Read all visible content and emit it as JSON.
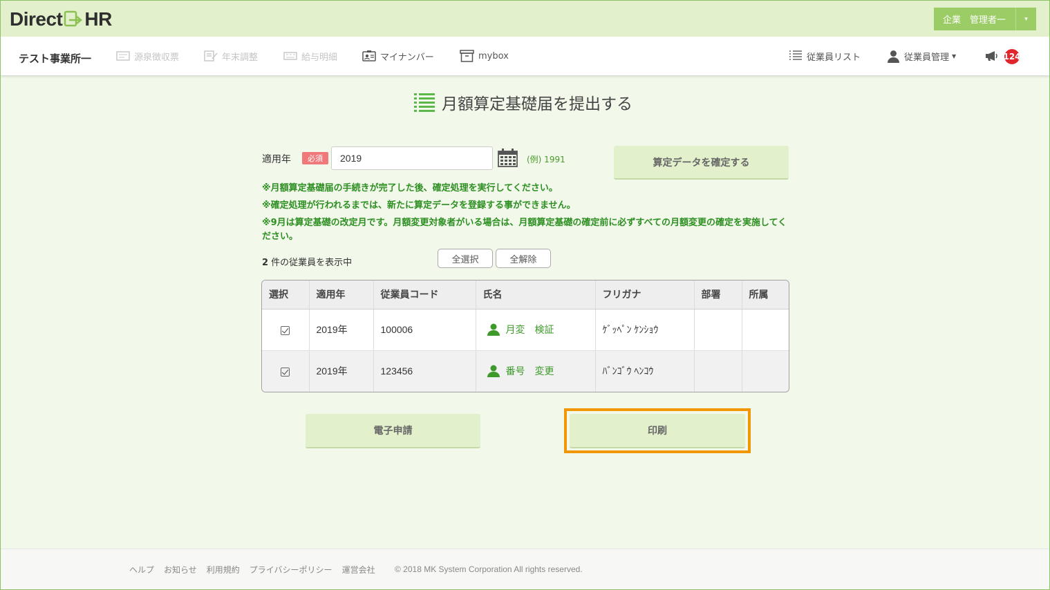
{
  "header": {
    "logo_left": "Direct",
    "logo_right": "HR",
    "user_menu_label": "企業　管理者一",
    "user_menu_caret": "▾"
  },
  "nav": {
    "office_name": "テスト事業所一",
    "items": [
      {
        "label": "源泉徴収票",
        "icon": "receipt-icon",
        "enabled": false
      },
      {
        "label": "年末調整",
        "icon": "document-edit-icon",
        "enabled": false
      },
      {
        "label": "給与明細",
        "icon": "payslip-icon",
        "enabled": false
      },
      {
        "label": "マイナンバー",
        "icon": "id-card-icon",
        "enabled": true
      },
      {
        "label": "mybox",
        "icon": "box-icon",
        "enabled": true
      }
    ],
    "employee_list": "従業員リスト",
    "employee_manage": "従業員管理",
    "notification_count": "124"
  },
  "page": {
    "title": "月額算定基礎届を提出する"
  },
  "form": {
    "year_label": "適用年",
    "required_badge": "必須",
    "year_value": "2019",
    "example": "(例) 1991",
    "confirm_button": "算定データを確定する",
    "notes": [
      "※月額算定基礎届の手続きが完了した後、確定処理を実行してください。",
      "※確定処理が行われるまでは、新たに算定データを登録する事ができません。",
      "※9月は算定基礎の改定月です。月額変更対象者がいる場合は、月額算定基礎の確定前に必ずすべての月額変更の確定を実施してください。"
    ],
    "count_number": "2",
    "count_suffix": " 件の従業員を表示中",
    "select_all": "全選択",
    "deselect_all": "全解除"
  },
  "table": {
    "headers": [
      "選択",
      "適用年",
      "従業員コード",
      "氏名",
      "フリガナ",
      "部署",
      "所属"
    ],
    "rows": [
      {
        "checked": true,
        "year": "2019年",
        "code": "100006",
        "name": "月変　検証",
        "kana": "ｹﾞｯﾍﾟﾝ ｹﾝｼｮｳ",
        "dept": "",
        "affiliation": ""
      },
      {
        "checked": true,
        "year": "2019年",
        "code": "123456",
        "name": "番号　変更",
        "kana": "ﾊﾞﾝｺﾞｳ ﾍﾝｺｳ",
        "dept": "",
        "affiliation": ""
      }
    ]
  },
  "actions": {
    "electronic": "電子申請",
    "print": "印刷"
  },
  "footer": {
    "links": [
      "ヘルプ",
      "お知らせ",
      "利用規約",
      "プライバシーポリシー",
      "運営会社"
    ],
    "copyright": "© 2018 MK System Corporation All rights reserved."
  },
  "colors": {
    "header_bg": "#e2f0cc",
    "accent_green": "#9ccc65",
    "note_green": "#2d8f22",
    "highlight_orange": "#f29600",
    "badge_red": "#e0262c"
  }
}
